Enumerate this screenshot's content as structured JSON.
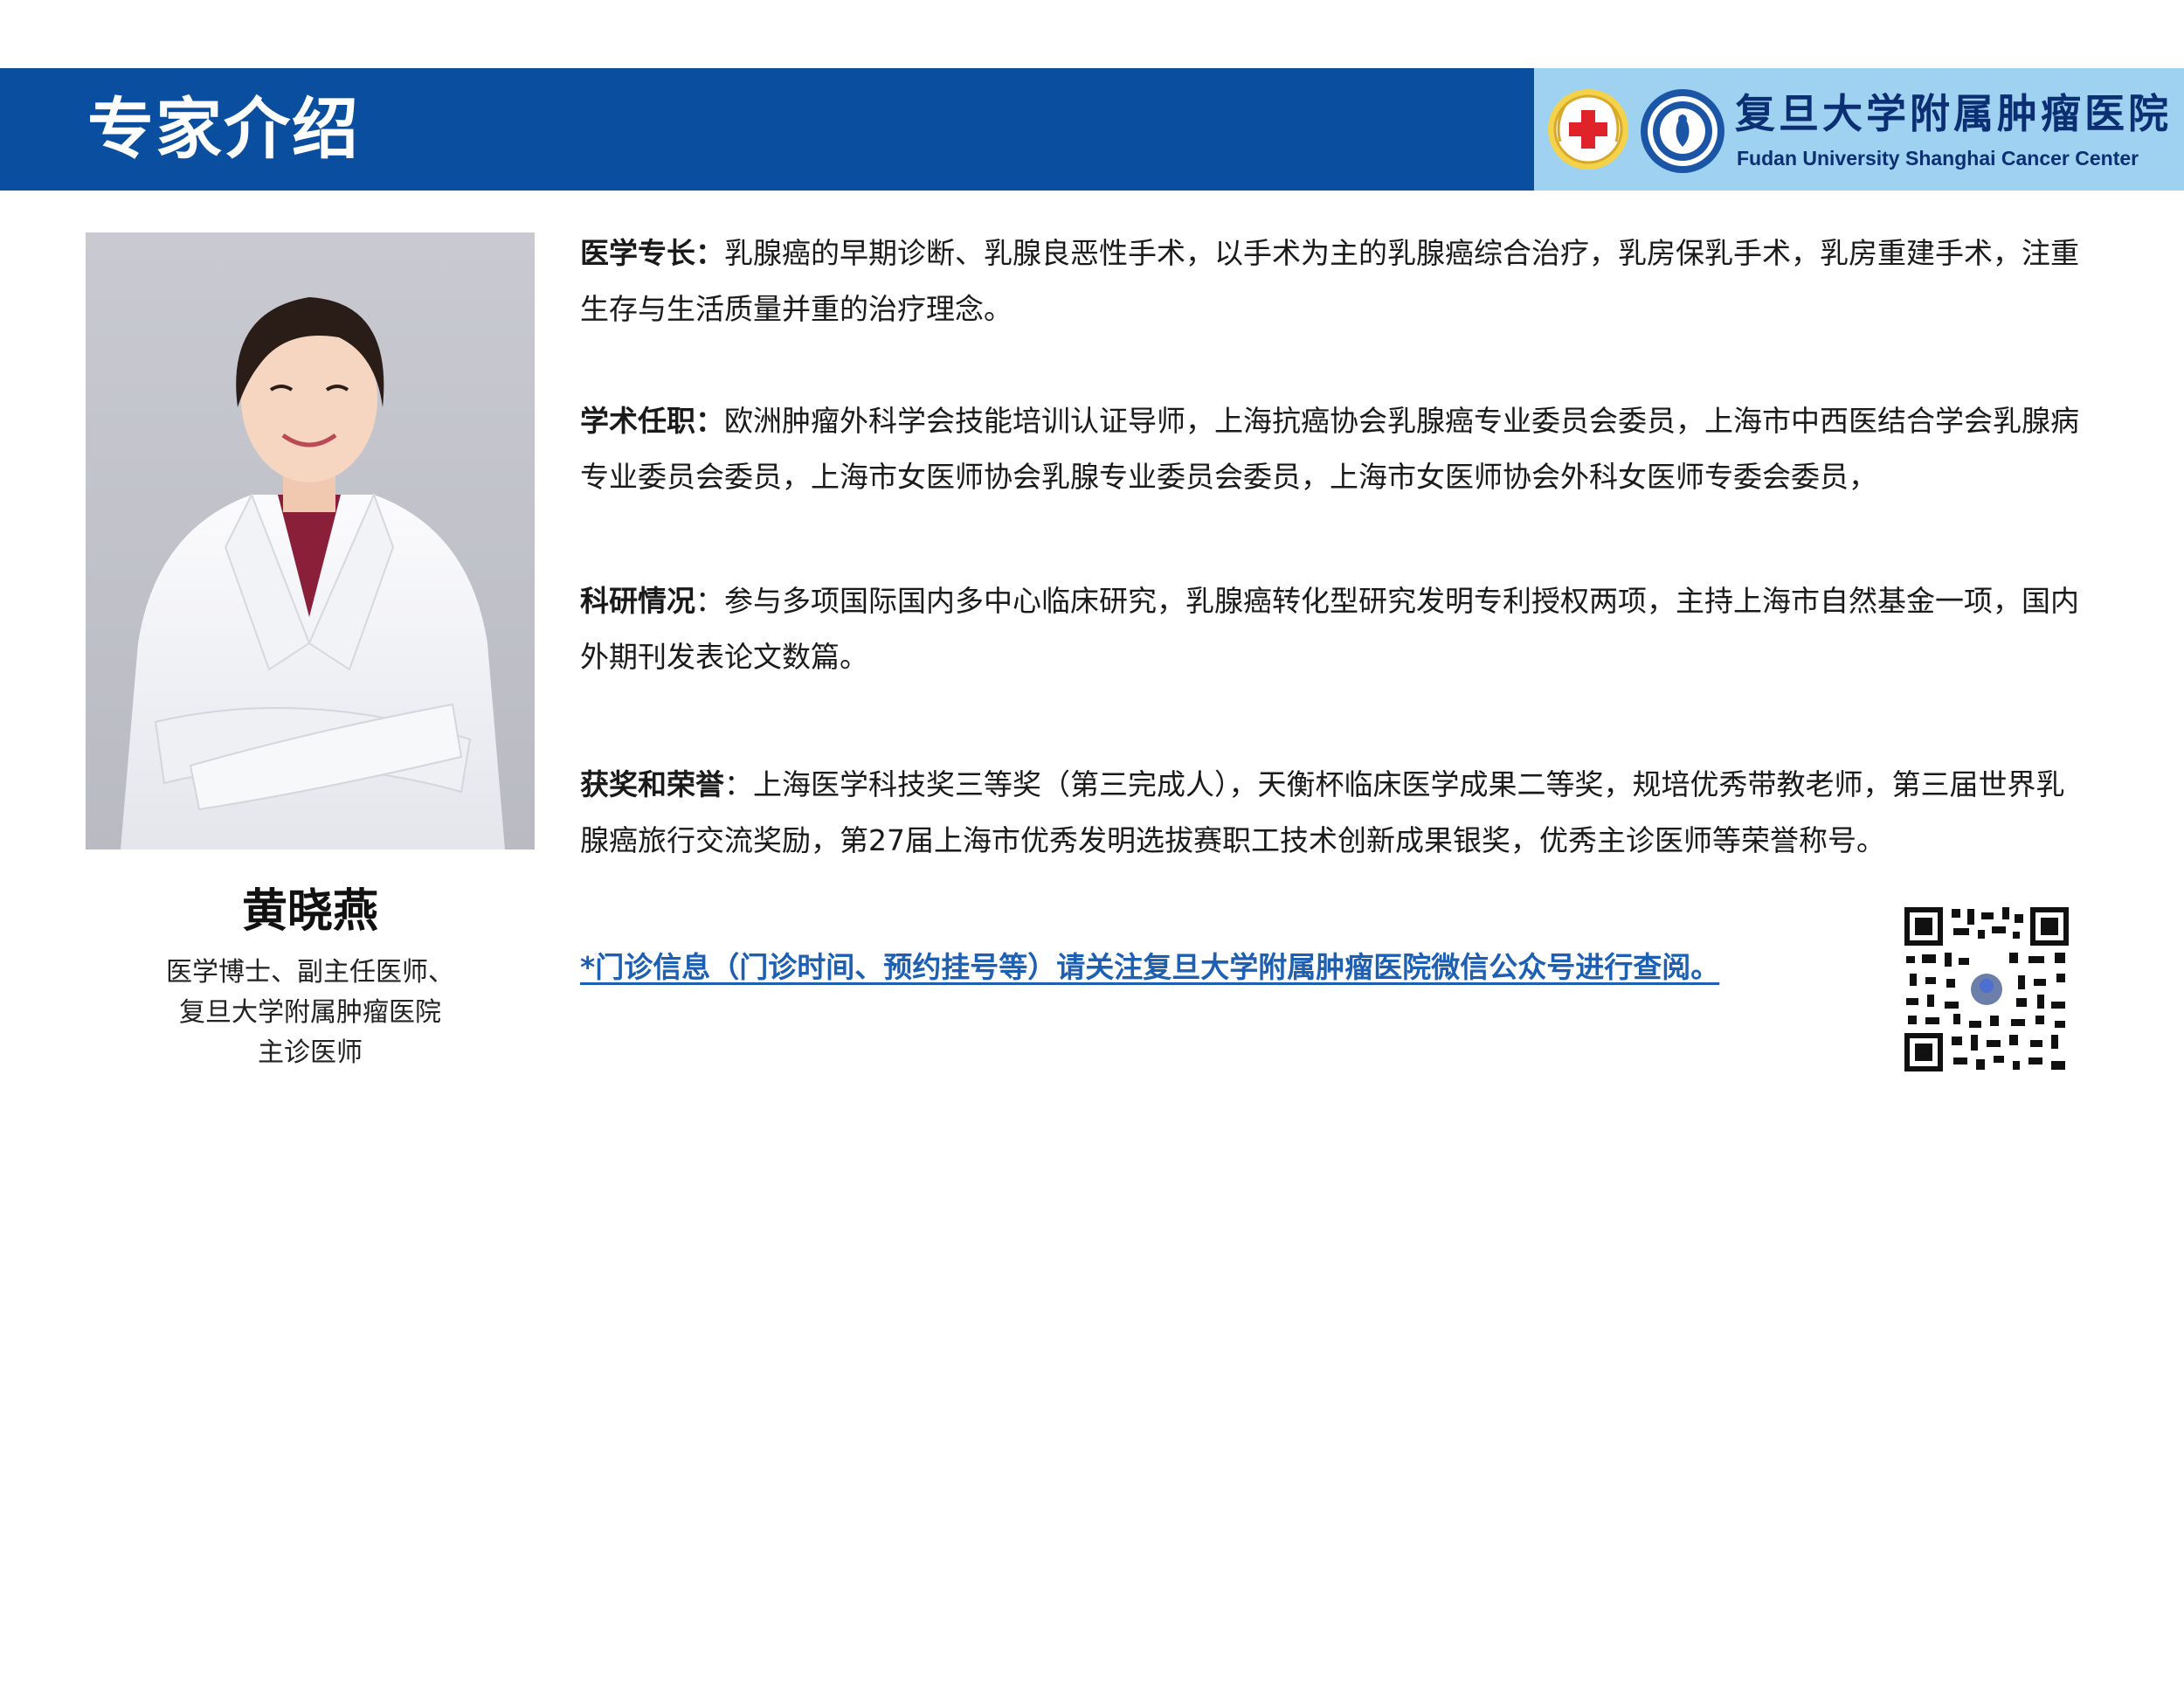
{
  "header": {
    "title": "专家介绍",
    "hospital_name_cn": "复旦大学附属肿瘤医院",
    "hospital_name_en": "Fudan University Shanghai Cancer Center",
    "bar_color": "#0a4ea0",
    "logo_panel_color": "#9fd2f0"
  },
  "expert": {
    "name": "黄晓燕",
    "title_lines": [
      "医学博士、副主任医师、",
      "复旦大学附属肿瘤医院",
      "主诊医师"
    ]
  },
  "sections": {
    "specialty": {
      "label": "医学专长：",
      "text": "乳腺癌的早期诊断、乳腺良恶性手术，以手术为主的乳腺癌综合治疗，乳房保乳手术，乳房重建手术，注重生存与生活质量并重的治疗理念。"
    },
    "positions": {
      "label": "学术任职：",
      "text": "欧洲肿瘤外科学会技能培训认证导师，上海抗癌协会乳腺癌专业委员会委员，上海市中西医结合学会乳腺病专业委员会委员，上海市女医师协会乳腺专业委员会委员，上海市女医师协会外科女医师专委会委员，"
    },
    "research": {
      "label": "科研情况",
      "text": "：参与多项国际国内多中心临床研究，乳腺癌转化型研究发明专利授权两项，主持上海市自然基金一项，国内外期刊发表论文数篇。"
    },
    "awards": {
      "label": "获奖和荣誉",
      "text": "：上海医学科技奖三等奖（第三完成人），天衡杯临床医学成果二等奖，规培优秀带教老师，第三届世界乳腺癌旅行交流奖励，第27届上海市优秀发明选拔赛职工技术创新成果银奖，优秀主诊医师等荣誉称号。"
    }
  },
  "clinic_notice": "*门诊信息（门诊时间、预约挂号等）请关注复旦大学附属肿瘤医院微信公众号进行查阅。",
  "colors": {
    "link": "#1c5fb3"
  }
}
